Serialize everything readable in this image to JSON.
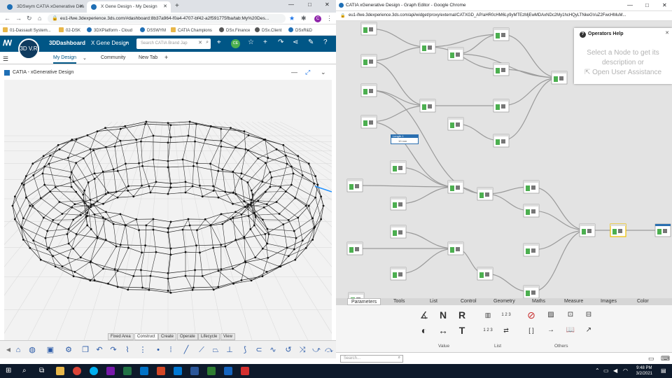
{
  "left_window": {
    "tabs": [
      {
        "label": "3DSwym CATIA xGenerative Des"
      },
      {
        "label": "X Gene Design - My Design"
      }
    ],
    "address": "eu1-ifwe.3dexperience.3ds.com/#dashboard:8b37a964-f0a4-4707-bf42-a2f591775fba/tab:My%20Des...",
    "bookmarks": [
      "01-Dassault System...",
      "02-DSK",
      "3DXPlatform - Cloud",
      "DSSWYM",
      "CATIA Champions",
      "DSx.Finance",
      "DSx.Client",
      "DSxR&D"
    ],
    "dashboard": {
      "title": "3DDashboard",
      "dashboard_name": "X Gene Design",
      "search_placeholder": "Search CATIA Brand Jap",
      "logo": "3D V.R",
      "avatar": "CE"
    },
    "dash_tabs": [
      "My Design",
      "Community",
      "New Tab"
    ],
    "app_title": "CATIA - xGenerative Design",
    "command_tabs": [
      "Fixed Area",
      "Construct",
      "Create",
      "Operate",
      "Lifecycle",
      "View"
    ],
    "active_command_tab": "Construct"
  },
  "right_window": {
    "title": "CATIA xGenerative Design - Graph Editor - Google Chrome",
    "address": "eu1-ifwe.3dexperience.3ds.com/api/widget/proxy/external/CATXGD_AP/aHR0cHM6Ly9yMTEzMjEwMDAxNDc2My1hcHQyLTNkeGVuZ2FwcHMuM...",
    "help": {
      "title": "Operators Help",
      "line1": "Select a Node to get its",
      "line2": "description or",
      "line3": "Open User Assistance"
    },
    "slider_node": {
      "title": "Length.1",
      "value": "10 mm"
    },
    "palette_tabs": [
      "Parameters",
      "Tools",
      "List",
      "Control",
      "Geometry",
      "Maths",
      "Measure",
      "Images",
      "Color"
    ],
    "active_palette_tab": "Parameters",
    "groups": [
      "Value",
      "List",
      "Others"
    ],
    "search_placeholder": "Search..."
  },
  "taskbar": {
    "time": "9:48 PM",
    "date": "3/2/2021"
  }
}
